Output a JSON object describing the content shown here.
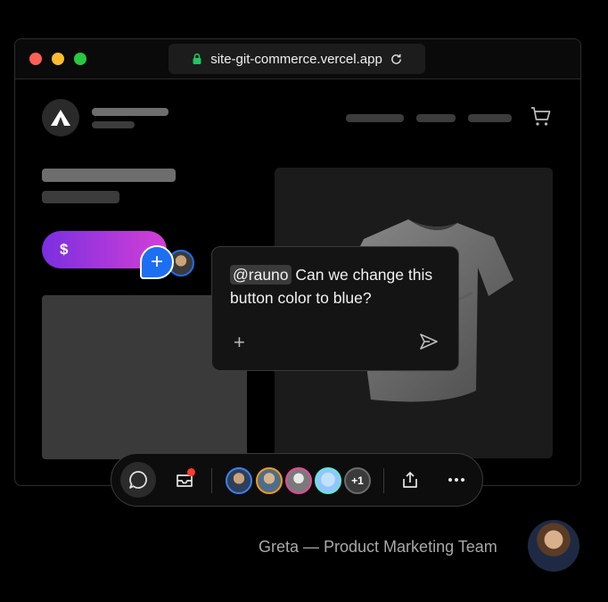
{
  "browser": {
    "url": "site-git-commerce.vercel.app",
    "colors": {
      "close": "#ff5f57",
      "minimize": "#febc2e",
      "maximize": "#28c840"
    }
  },
  "site": {
    "price_symbol": "$",
    "price_button_gradient": [
      "#7a2fe0",
      "#d43fd6"
    ]
  },
  "comment": {
    "mention": "@rauno",
    "text": " Can we change this button color to blue?",
    "add_symbol": "+",
    "pin_symbol": "+"
  },
  "toolbar": {
    "more_count": "+1",
    "icons": [
      "comment-icon",
      "inbox-icon",
      "share-icon",
      "more-icon"
    ]
  },
  "footer": {
    "caption": "Greta — Product Marketing Team"
  }
}
